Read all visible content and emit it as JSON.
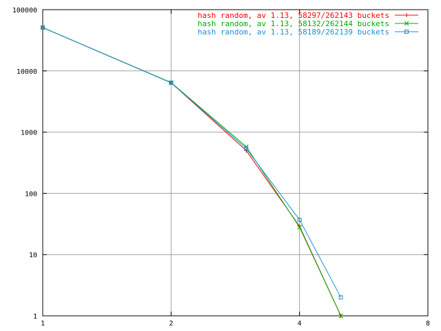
{
  "chart_data": {
    "type": "line",
    "title": "",
    "xlabel": "",
    "ylabel": "",
    "x_scale": "log2",
    "y_scale": "log10",
    "xlim": [
      1,
      8
    ],
    "ylim": [
      1,
      100000
    ],
    "grid": true,
    "legend_position": "top-right",
    "x_ticks": [
      "1",
      "2",
      "4",
      "8"
    ],
    "y_ticks": [
      "1",
      "10",
      "100",
      "1000",
      "10000",
      "100000"
    ],
    "series": [
      {
        "name": "hash random, av 1.13, 58297/262143 buckets",
        "color": "#ff0000",
        "marker": "plus",
        "x": [
          1,
          2,
          3,
          4,
          5
        ],
        "y": [
          51000,
          6400,
          500,
          29,
          1
        ]
      },
      {
        "name": "hash random, av 1.13, 58132/262144 buckets",
        "color": "#00aa00",
        "marker": "cross",
        "x": [
          1,
          2,
          3,
          4,
          5
        ],
        "y": [
          51000,
          6450,
          580,
          28,
          1
        ]
      },
      {
        "name": "hash random, av 1.13, 58189/262139 buckets",
        "color": "#1a8fd0",
        "marker": "square",
        "x": [
          1,
          2,
          3,
          4,
          5
        ],
        "y": [
          51000,
          6400,
          540,
          37,
          2
        ]
      }
    ]
  }
}
